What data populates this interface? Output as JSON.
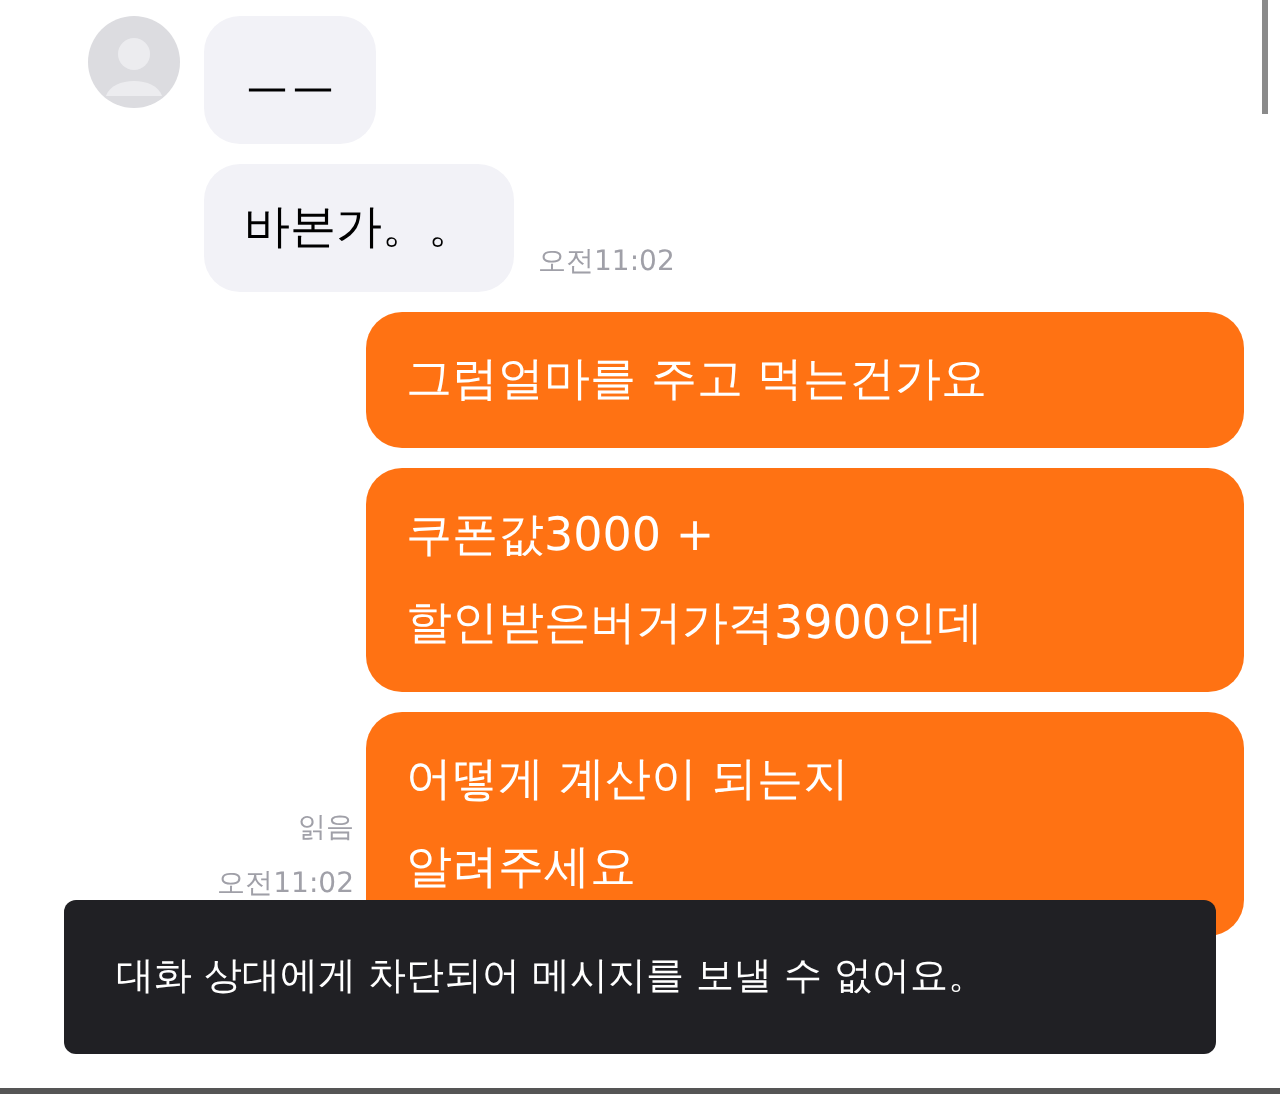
{
  "messages": [
    {
      "kind": "received",
      "lines": [
        "ㅡㅡ"
      ]
    },
    {
      "kind": "received",
      "lines": [
        "바본가。。"
      ],
      "time": "오전11:02"
    },
    {
      "kind": "sent",
      "lines": [
        "그럼얼마를 주고 먹는건가요"
      ]
    },
    {
      "kind": "sent",
      "lines": [
        "쿠폰값3000 +",
        "할인받은버거가격3900인데"
      ]
    },
    {
      "kind": "sent",
      "lines": [
        "어떻게 계산이 되는지",
        "알려주세요"
      ],
      "read": "읽음",
      "time": "오전11:02"
    }
  ],
  "toast": "대화 상대에게 차단되어 메시지를 보낼 수 없어요。"
}
